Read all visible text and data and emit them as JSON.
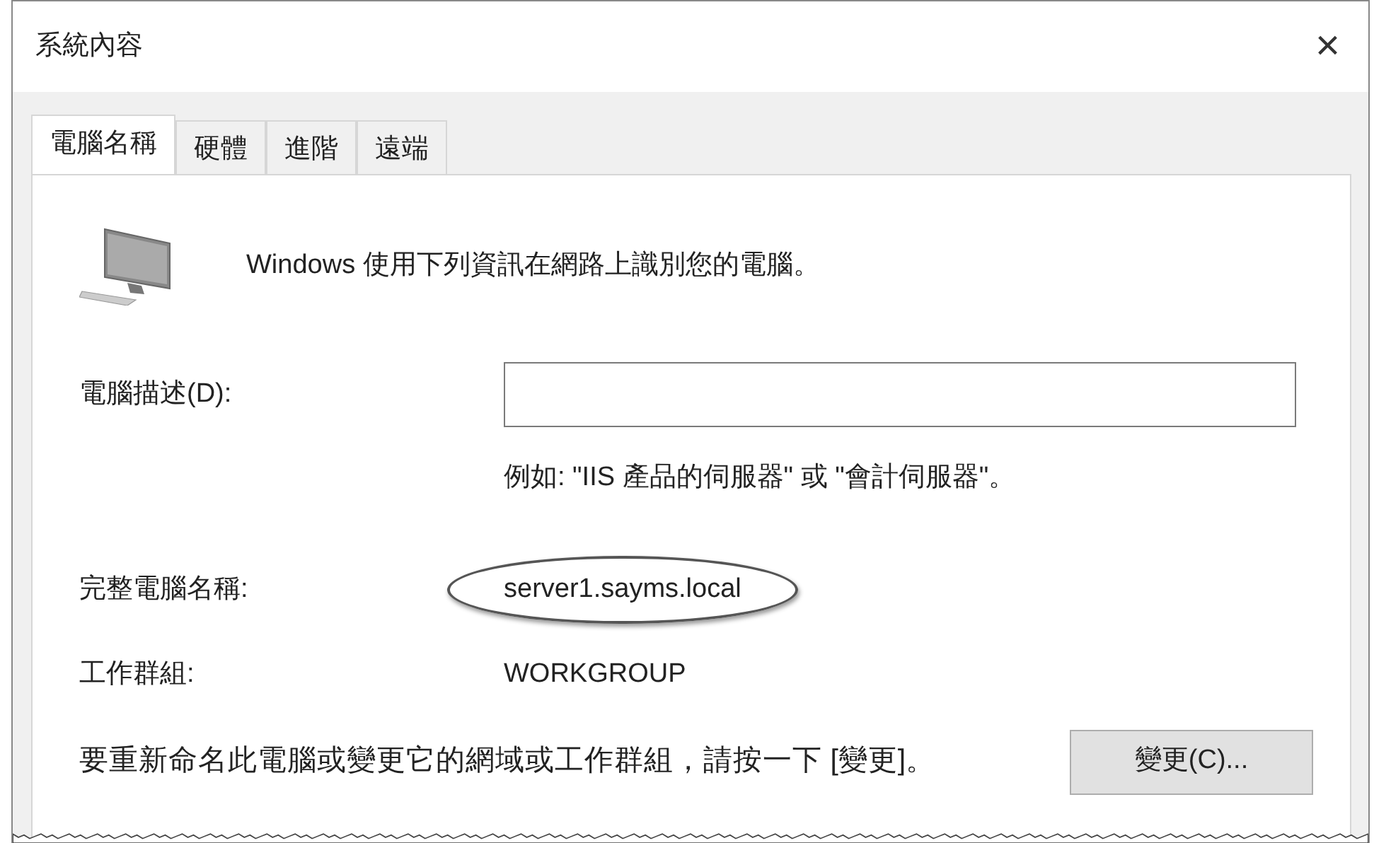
{
  "window": {
    "title": "系統內容",
    "close": "×"
  },
  "tabs": [
    {
      "label": "電腦名稱",
      "selected": true
    },
    {
      "label": "硬體",
      "selected": false
    },
    {
      "label": "進階",
      "selected": false
    },
    {
      "label": "遠端",
      "selected": false
    }
  ],
  "intro": "Windows 使用下列資訊在網路上識別您的電腦。",
  "description": {
    "label": "電腦描述(D):",
    "hint": "例如: \"IIS 產品的伺服器\" 或 \"會計伺服器\"。"
  },
  "full_name": {
    "label": "完整電腦名稱:",
    "value": "server1.sayms.local",
    "circled": true
  },
  "workgroup": {
    "label": "工作群組:",
    "value": "WORKGROUP"
  },
  "rename": {
    "text": "要重新命名此電腦或變更它的網域或工作群組，請按一下 [變更]。",
    "button": "變更(C)..."
  }
}
